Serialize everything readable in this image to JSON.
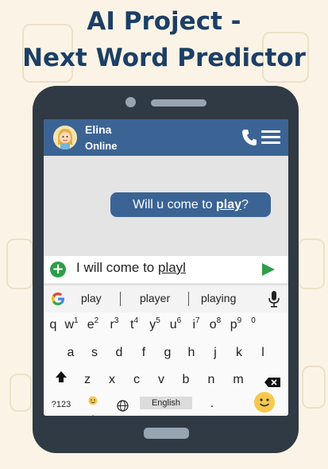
{
  "page": {
    "title_line1": "AI Project -",
    "title_line2": "Next Word Predictor"
  },
  "chat": {
    "contact_name": "Elina",
    "contact_status": "Online",
    "message_prefix": "Will u come to ",
    "message_highlight": "play",
    "message_suffix": "?"
  },
  "input": {
    "typed_prefix": "I will come to ",
    "typed_word": "playl"
  },
  "suggestions": [
    "play",
    "player",
    "playing"
  ],
  "keyboard": {
    "row1": [
      {
        "k": "q",
        "n": ""
      },
      {
        "k": "w",
        "n": "1"
      },
      {
        "k": "e",
        "n": "2"
      },
      {
        "k": "r",
        "n": "3"
      },
      {
        "k": "t",
        "n": "4"
      },
      {
        "k": "y",
        "n": "5"
      },
      {
        "k": "u",
        "n": "6"
      },
      {
        "k": "i",
        "n": "7"
      },
      {
        "k": "o",
        "n": "8"
      },
      {
        "k": "p",
        "n": "9"
      },
      {
        "k": "",
        "n": "0"
      }
    ],
    "row2": [
      "a",
      "s",
      "d",
      "f",
      "g",
      "h",
      "j",
      "k",
      "l"
    ],
    "row3": [
      "z",
      "x",
      "c",
      "v",
      "b",
      "n",
      "m"
    ],
    "symbols_label": "?123",
    "comma": ",",
    "language": "English",
    "period": "."
  },
  "icons": {
    "add": "plus-circle-icon",
    "send": "send-icon",
    "call": "phone-icon",
    "menu": "menu-icon",
    "google": "google-icon",
    "mic": "microphone-icon",
    "shift": "shift-arrow-icon",
    "backspace": "backspace-icon",
    "globe": "globe-icon",
    "emoji": "emoji-icon"
  },
  "colors": {
    "title": "#1c3f66",
    "header": "#3b6494",
    "bubble": "#3b6494",
    "phone_body": "#2f3a44",
    "accent_green": "#2e9e47",
    "background": "#fbf4e6"
  }
}
